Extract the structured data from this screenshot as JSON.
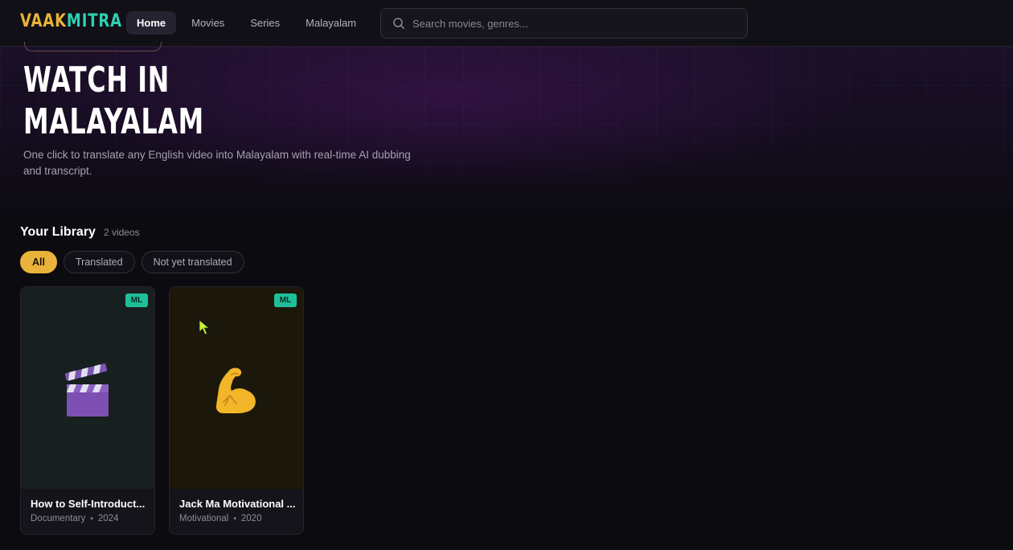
{
  "brand": {
    "part1": "VAAK",
    "part2": "MITRA",
    "color1": "#e9b23a",
    "color2": "#2fd0b2"
  },
  "nav": {
    "items": [
      {
        "label": "Home",
        "active": true
      },
      {
        "label": "Movies",
        "active": false
      },
      {
        "label": "Series",
        "active": false
      },
      {
        "label": "Malayalam",
        "active": false
      }
    ]
  },
  "search": {
    "placeholder": "Search movies, genres...",
    "value": "",
    "icon": "search-icon"
  },
  "hero": {
    "title_line1": "WATCH IN",
    "title_line2": "MALAYALAM",
    "subtitle": "One click to translate any English video into Malayalam with real-time AI dubbing and transcript."
  },
  "library": {
    "title": "Your Library",
    "count": "2 videos",
    "filters": [
      {
        "label": "All",
        "active": true
      },
      {
        "label": "Translated",
        "active": false
      },
      {
        "label": "Not yet translated",
        "active": false
      }
    ],
    "videos": [
      {
        "title": "How to Self-Introduct...",
        "badge": "ML",
        "genre": "Documentary",
        "year": "2024",
        "icon": "clapperboard-icon",
        "thumb_color": "#17201f"
      },
      {
        "title": "Jack Ma Motivational ...",
        "badge": "ML",
        "genre": "Motivational",
        "year": "2020",
        "icon": "flexed-biceps-icon",
        "thumb_color": "#1c170b"
      }
    ]
  },
  "colors": {
    "accent": "#e9b23a",
    "badge": "#1fbf9a",
    "background": "#0c0b10"
  }
}
